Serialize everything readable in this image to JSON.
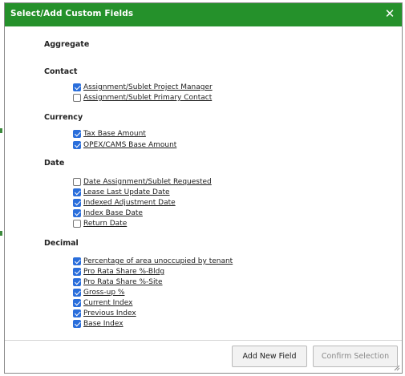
{
  "dialog": {
    "title": "Select/Add Custom Fields",
    "close_icon": "close-icon"
  },
  "groups": [
    {
      "title": "Aggregate",
      "fields": []
    },
    {
      "title": "Contact",
      "fields": [
        {
          "label": "Assignment/Sublet Project Manager",
          "checked": true
        },
        {
          "label": "Assignment/Sublet Primary Contact",
          "checked": false
        }
      ]
    },
    {
      "title": "Currency",
      "fields": [
        {
          "label": "Tax Base Amount",
          "checked": true
        },
        {
          "label": "OPEX/CAMS Base Amount",
          "checked": true
        }
      ]
    },
    {
      "title": "Date",
      "fields": [
        {
          "label": "Date Assignment/Sublet Requested",
          "checked": false
        },
        {
          "label": "Lease Last Update Date",
          "checked": true
        },
        {
          "label": "Indexed Adjustment Date",
          "checked": true
        },
        {
          "label": "Index Base Date",
          "checked": true
        },
        {
          "label": "Return Date",
          "checked": false
        }
      ]
    },
    {
      "title": "Decimal",
      "fields": [
        {
          "label": "Percentage of area unoccupied by tenant",
          "checked": true
        },
        {
          "label": "Pro Rata Share %-Bldg",
          "checked": true
        },
        {
          "label": "Pro Rata Share %-Site",
          "checked": true
        },
        {
          "label": "Gross-up %",
          "checked": true
        },
        {
          "label": "Current Index",
          "checked": true
        },
        {
          "label": "Previous Index",
          "checked": true
        },
        {
          "label": "Base Index",
          "checked": true
        }
      ]
    }
  ],
  "footer": {
    "add_new_field_label": "Add New Field",
    "confirm_selection_label": "Confirm Selection"
  },
  "colors": {
    "title_bar": "#25912b",
    "checkbox_checked": "#2a6edb"
  }
}
